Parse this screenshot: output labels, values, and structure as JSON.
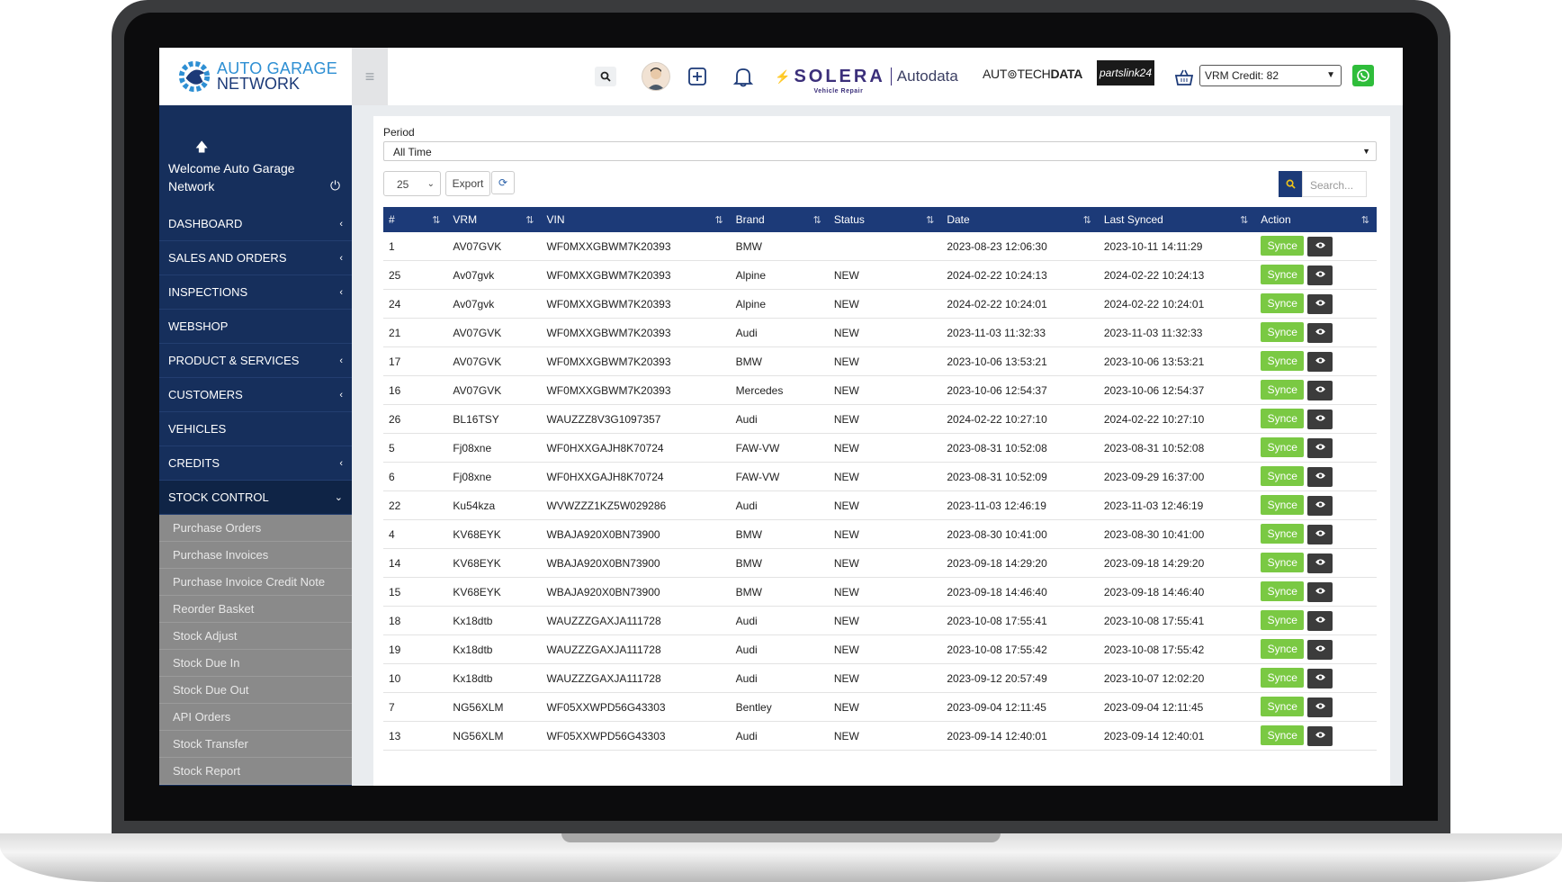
{
  "app": {
    "logo_line1": "AUTO GARAGE",
    "logo_line2": "NETWORK"
  },
  "topbar": {
    "solera_brand": "SOLERA",
    "solera_sub": "Vehicle Repair",
    "autodata": "Autodata",
    "autotech_pre": "AUT⊚TECH",
    "autotech_bold": "DATA",
    "partslink": "partslink24",
    "vrm_credit": "VRM Credit: 82"
  },
  "sidebar": {
    "welcome": "Welcome Auto Garage Network",
    "nav": [
      {
        "label": "DASHBOARD",
        "chevron": "‹"
      },
      {
        "label": "SALES AND ORDERS",
        "chevron": "‹"
      },
      {
        "label": "INSPECTIONS",
        "chevron": "‹"
      },
      {
        "label": "WEBSHOP",
        "chevron": ""
      },
      {
        "label": "PRODUCT & SERVICES",
        "chevron": "‹"
      },
      {
        "label": "CUSTOMERS",
        "chevron": "‹"
      },
      {
        "label": "VEHICLES",
        "chevron": ""
      },
      {
        "label": "CREDITS",
        "chevron": "‹"
      },
      {
        "label": "STOCK CONTROL",
        "chevron": "⌄"
      }
    ],
    "stock_control_items": [
      "Purchase Orders",
      "Purchase Invoices",
      "Purchase Invoice Credit Note",
      "Reorder Basket",
      "Stock Adjust",
      "Stock Due In",
      "Stock Due Out",
      "API Orders",
      "Stock Transfer",
      "Stock Report"
    ]
  },
  "main": {
    "period_label": "Period",
    "period_value": "All Time",
    "page_length": "25",
    "export_label": "Export",
    "search_placeholder": "Search...",
    "columns": [
      "#",
      "VRM",
      "VIN",
      "Brand",
      "Status",
      "Date",
      "Last Synced",
      "Action"
    ],
    "synce_label": "Synce",
    "rows": [
      [
        "1",
        "AV07GVK",
        "WF0MXXGBWM7K20393",
        "BMW",
        "",
        "2023-08-23 12:06:30",
        "2023-10-11 14:11:29"
      ],
      [
        "25",
        "Av07gvk",
        "WF0MXXGBWM7K20393",
        "Alpine",
        "NEW",
        "2024-02-22 10:24:13",
        "2024-02-22 10:24:13"
      ],
      [
        "24",
        "Av07gvk",
        "WF0MXXGBWM7K20393",
        "Alpine",
        "NEW",
        "2024-02-22 10:24:01",
        "2024-02-22 10:24:01"
      ],
      [
        "21",
        "AV07GVK",
        "WF0MXXGBWM7K20393",
        "Audi",
        "NEW",
        "2023-11-03 11:32:33",
        "2023-11-03 11:32:33"
      ],
      [
        "17",
        "AV07GVK",
        "WF0MXXGBWM7K20393",
        "BMW",
        "NEW",
        "2023-10-06 13:53:21",
        "2023-10-06 13:53:21"
      ],
      [
        "16",
        "AV07GVK",
        "WF0MXXGBWM7K20393",
        "Mercedes",
        "NEW",
        "2023-10-06 12:54:37",
        "2023-10-06 12:54:37"
      ],
      [
        "26",
        "BL16TSY",
        "WAUZZZ8V3G1097357",
        "Audi",
        "NEW",
        "2024-02-22 10:27:10",
        "2024-02-22 10:27:10"
      ],
      [
        "5",
        "Fj08xne",
        "WF0HXXGAJH8K70724",
        "FAW-VW",
        "NEW",
        "2023-08-31 10:52:08",
        "2023-08-31 10:52:08"
      ],
      [
        "6",
        "Fj08xne",
        "WF0HXXGAJH8K70724",
        "FAW-VW",
        "NEW",
        "2023-08-31 10:52:09",
        "2023-09-29 16:37:00"
      ],
      [
        "22",
        "Ku54kza",
        "WVWZZZ1KZ5W029286",
        "Audi",
        "NEW",
        "2023-11-03 12:46:19",
        "2023-11-03 12:46:19"
      ],
      [
        "4",
        "KV68EYK",
        "WBAJA920X0BN73900",
        "BMW",
        "NEW",
        "2023-08-30 10:41:00",
        "2023-08-30 10:41:00"
      ],
      [
        "14",
        "KV68EYK",
        "WBAJA920X0BN73900",
        "BMW",
        "NEW",
        "2023-09-18 14:29:20",
        "2023-09-18 14:29:20"
      ],
      [
        "15",
        "KV68EYK",
        "WBAJA920X0BN73900",
        "BMW",
        "NEW",
        "2023-09-18 14:46:40",
        "2023-09-18 14:46:40"
      ],
      [
        "18",
        "Kx18dtb",
        "WAUZZZGAXJA111728",
        "Audi",
        "NEW",
        "2023-10-08 17:55:41",
        "2023-10-08 17:55:41"
      ],
      [
        "19",
        "Kx18dtb",
        "WAUZZZGAXJA111728",
        "Audi",
        "NEW",
        "2023-10-08 17:55:42",
        "2023-10-08 17:55:42"
      ],
      [
        "10",
        "Kx18dtb",
        "WAUZZZGAXJA111728",
        "Audi",
        "NEW",
        "2023-09-12 20:57:49",
        "2023-10-07 12:02:20"
      ],
      [
        "7",
        "NG56XLM",
        "WF05XXWPD56G43303",
        "Bentley",
        "NEW",
        "2023-09-04 12:11:45",
        "2023-09-04 12:11:45"
      ],
      [
        "13",
        "NG56XLM",
        "WF05XXWPD56G43303",
        "Audi",
        "NEW",
        "2023-09-14 12:40:01",
        "2023-09-14 12:40:01"
      ]
    ]
  },
  "colors": {
    "sidebar_bg": "#162f5c",
    "header_bg": "#1c3a78",
    "synce_green": "#7ac943",
    "submenu_grey": "#8a8a8a"
  }
}
